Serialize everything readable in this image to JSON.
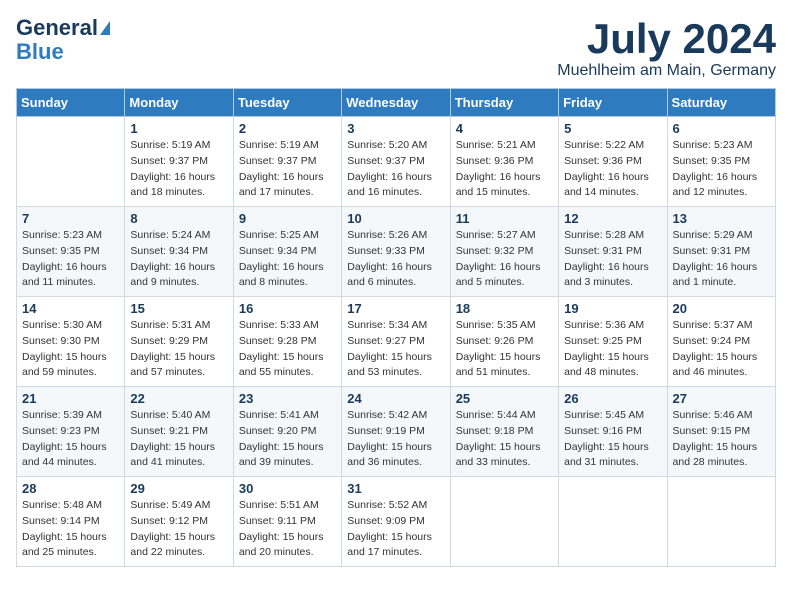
{
  "header": {
    "logo_line1": "General",
    "logo_line2": "Blue",
    "month_title": "July 2024",
    "location": "Muehlheim am Main, Germany"
  },
  "columns": [
    "Sunday",
    "Monday",
    "Tuesday",
    "Wednesday",
    "Thursday",
    "Friday",
    "Saturday"
  ],
  "weeks": [
    [
      {
        "day": "",
        "details": ""
      },
      {
        "day": "1",
        "details": "Sunrise: 5:19 AM\nSunset: 9:37 PM\nDaylight: 16 hours\nand 18 minutes."
      },
      {
        "day": "2",
        "details": "Sunrise: 5:19 AM\nSunset: 9:37 PM\nDaylight: 16 hours\nand 17 minutes."
      },
      {
        "day": "3",
        "details": "Sunrise: 5:20 AM\nSunset: 9:37 PM\nDaylight: 16 hours\nand 16 minutes."
      },
      {
        "day": "4",
        "details": "Sunrise: 5:21 AM\nSunset: 9:36 PM\nDaylight: 16 hours\nand 15 minutes."
      },
      {
        "day": "5",
        "details": "Sunrise: 5:22 AM\nSunset: 9:36 PM\nDaylight: 16 hours\nand 14 minutes."
      },
      {
        "day": "6",
        "details": "Sunrise: 5:23 AM\nSunset: 9:35 PM\nDaylight: 16 hours\nand 12 minutes."
      }
    ],
    [
      {
        "day": "7",
        "details": "Sunrise: 5:23 AM\nSunset: 9:35 PM\nDaylight: 16 hours\nand 11 minutes."
      },
      {
        "day": "8",
        "details": "Sunrise: 5:24 AM\nSunset: 9:34 PM\nDaylight: 16 hours\nand 9 minutes."
      },
      {
        "day": "9",
        "details": "Sunrise: 5:25 AM\nSunset: 9:34 PM\nDaylight: 16 hours\nand 8 minutes."
      },
      {
        "day": "10",
        "details": "Sunrise: 5:26 AM\nSunset: 9:33 PM\nDaylight: 16 hours\nand 6 minutes."
      },
      {
        "day": "11",
        "details": "Sunrise: 5:27 AM\nSunset: 9:32 PM\nDaylight: 16 hours\nand 5 minutes."
      },
      {
        "day": "12",
        "details": "Sunrise: 5:28 AM\nSunset: 9:31 PM\nDaylight: 16 hours\nand 3 minutes."
      },
      {
        "day": "13",
        "details": "Sunrise: 5:29 AM\nSunset: 9:31 PM\nDaylight: 16 hours\nand 1 minute."
      }
    ],
    [
      {
        "day": "14",
        "details": "Sunrise: 5:30 AM\nSunset: 9:30 PM\nDaylight: 15 hours\nand 59 minutes."
      },
      {
        "day": "15",
        "details": "Sunrise: 5:31 AM\nSunset: 9:29 PM\nDaylight: 15 hours\nand 57 minutes."
      },
      {
        "day": "16",
        "details": "Sunrise: 5:33 AM\nSunset: 9:28 PM\nDaylight: 15 hours\nand 55 minutes."
      },
      {
        "day": "17",
        "details": "Sunrise: 5:34 AM\nSunset: 9:27 PM\nDaylight: 15 hours\nand 53 minutes."
      },
      {
        "day": "18",
        "details": "Sunrise: 5:35 AM\nSunset: 9:26 PM\nDaylight: 15 hours\nand 51 minutes."
      },
      {
        "day": "19",
        "details": "Sunrise: 5:36 AM\nSunset: 9:25 PM\nDaylight: 15 hours\nand 48 minutes."
      },
      {
        "day": "20",
        "details": "Sunrise: 5:37 AM\nSunset: 9:24 PM\nDaylight: 15 hours\nand 46 minutes."
      }
    ],
    [
      {
        "day": "21",
        "details": "Sunrise: 5:39 AM\nSunset: 9:23 PM\nDaylight: 15 hours\nand 44 minutes."
      },
      {
        "day": "22",
        "details": "Sunrise: 5:40 AM\nSunset: 9:21 PM\nDaylight: 15 hours\nand 41 minutes."
      },
      {
        "day": "23",
        "details": "Sunrise: 5:41 AM\nSunset: 9:20 PM\nDaylight: 15 hours\nand 39 minutes."
      },
      {
        "day": "24",
        "details": "Sunrise: 5:42 AM\nSunset: 9:19 PM\nDaylight: 15 hours\nand 36 minutes."
      },
      {
        "day": "25",
        "details": "Sunrise: 5:44 AM\nSunset: 9:18 PM\nDaylight: 15 hours\nand 33 minutes."
      },
      {
        "day": "26",
        "details": "Sunrise: 5:45 AM\nSunset: 9:16 PM\nDaylight: 15 hours\nand 31 minutes."
      },
      {
        "day": "27",
        "details": "Sunrise: 5:46 AM\nSunset: 9:15 PM\nDaylight: 15 hours\nand 28 minutes."
      }
    ],
    [
      {
        "day": "28",
        "details": "Sunrise: 5:48 AM\nSunset: 9:14 PM\nDaylight: 15 hours\nand 25 minutes."
      },
      {
        "day": "29",
        "details": "Sunrise: 5:49 AM\nSunset: 9:12 PM\nDaylight: 15 hours\nand 22 minutes."
      },
      {
        "day": "30",
        "details": "Sunrise: 5:51 AM\nSunset: 9:11 PM\nDaylight: 15 hours\nand 20 minutes."
      },
      {
        "day": "31",
        "details": "Sunrise: 5:52 AM\nSunset: 9:09 PM\nDaylight: 15 hours\nand 17 minutes."
      },
      {
        "day": "",
        "details": ""
      },
      {
        "day": "",
        "details": ""
      },
      {
        "day": "",
        "details": ""
      }
    ]
  ]
}
